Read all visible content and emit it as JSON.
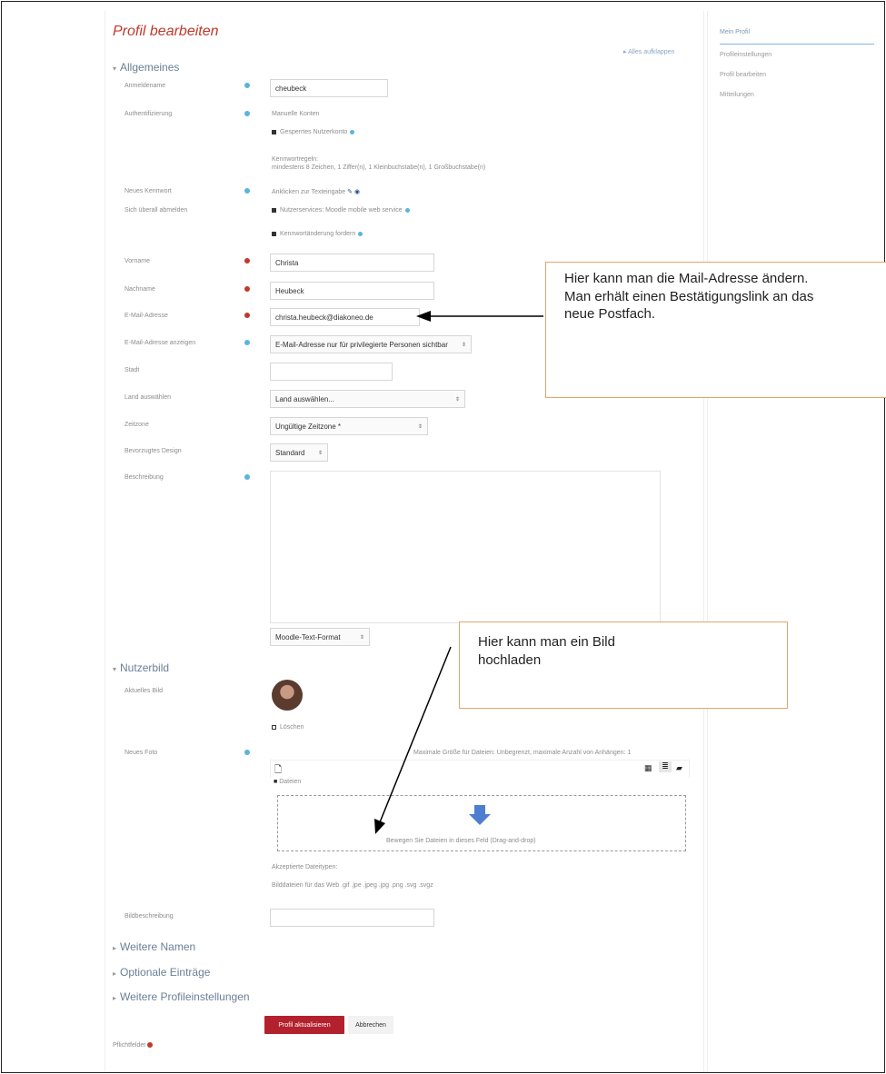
{
  "page": {
    "title": "Profil bearbeiten",
    "expand_all": "Alles aufklappen"
  },
  "sidebar": {
    "items": [
      {
        "label": "Mein Profil"
      },
      {
        "label": "Profileinstellungen"
      },
      {
        "label": "Profil bearbeiten"
      },
      {
        "label": "Mitteilungen"
      }
    ]
  },
  "sections": {
    "general": "Allgemeines",
    "userpic": "Nutzerbild",
    "more_names": "Weitere Namen",
    "optional": "Optionale Einträge",
    "more_profile": "Weitere Profileinstellungen"
  },
  "fields": {
    "username": {
      "label": "Anmeldename",
      "value": "cheubeck"
    },
    "auth": {
      "label": "Authentifizierung",
      "value": "Manuelle Konten",
      "suspended": "Gesperrtes Nutzerkonto",
      "policy_title": "Kennwortregeln:",
      "policy_text": "mindestens 8 Zeichen, 1 Ziffer(n), 1 Kleinbuchstabe(n), 1 Großbuchstabe(n)"
    },
    "new_password": {
      "label": "Neues Kennwort",
      "value": "Anklicken zur Texteingabe"
    },
    "logout": {
      "label": "Sich überall abmelden",
      "service": "Nutzerservices: Moodle mobile web service",
      "force_change": "Kennwortänderung fordern"
    },
    "firstname": {
      "label": "Vorname",
      "value": "Christa"
    },
    "lastname": {
      "label": "Nachname",
      "value": "Heubeck"
    },
    "email": {
      "label": "E-Mail-Adresse",
      "value": "christa.heubeck@diakoneo.de"
    },
    "email_display": {
      "label": "E-Mail-Adresse anzeigen",
      "value": "E-Mail-Adresse nur für privilegierte Personen sichtbar"
    },
    "city": {
      "label": "Stadt",
      "value": ""
    },
    "country": {
      "label": "Land auswählen",
      "value": "Land auswählen..."
    },
    "timezone": {
      "label": "Zeitzone",
      "value": "Ungültige Zeitzone *"
    },
    "theme": {
      "label": "Bevorzugtes Design",
      "value": "Standard"
    },
    "description": {
      "label": "Beschreibung",
      "format": "Moodle-Text-Format"
    },
    "current_pic": {
      "label": "Aktuelles Bild",
      "delete": "Löschen"
    },
    "new_pic": {
      "label": "Neues Foto",
      "limits": "Maximale Größe für Dateien: Unbegrenzt, maximale Anzahl von Anhängen: 1",
      "folder": "Dateien",
      "drop_hint": "Bewegen Sie Dateien in dieses Feld (Drag-and-drop)",
      "accepted_title": "Akzeptierte Dateitypen:",
      "accepted_list": "Bilddateien für das Web .gif .jpe .jpeg .jpg .png .svg .svgz"
    },
    "image_alt": {
      "label": "Bildbeschreibung",
      "value": ""
    }
  },
  "buttons": {
    "submit": "Profil aktualisieren",
    "cancel": "Abbrechen"
  },
  "required_note": "Pflichtfelder",
  "callouts": {
    "email": {
      "line1": "Hier kann man die Mail-Adresse ändern.",
      "line2": "Man erhält einen Bestätigungslink an das",
      "line3": "neue Postfach."
    },
    "picture": {
      "line1": "Hier kann man ein Bild",
      "line2": "hochladen"
    }
  },
  "colors": {
    "title": "#c0392b",
    "required_icon": "#c0392b",
    "info_icon": "#5ab4dc",
    "primary_button": "#b3212e",
    "callout_border": "#e6a36a"
  }
}
